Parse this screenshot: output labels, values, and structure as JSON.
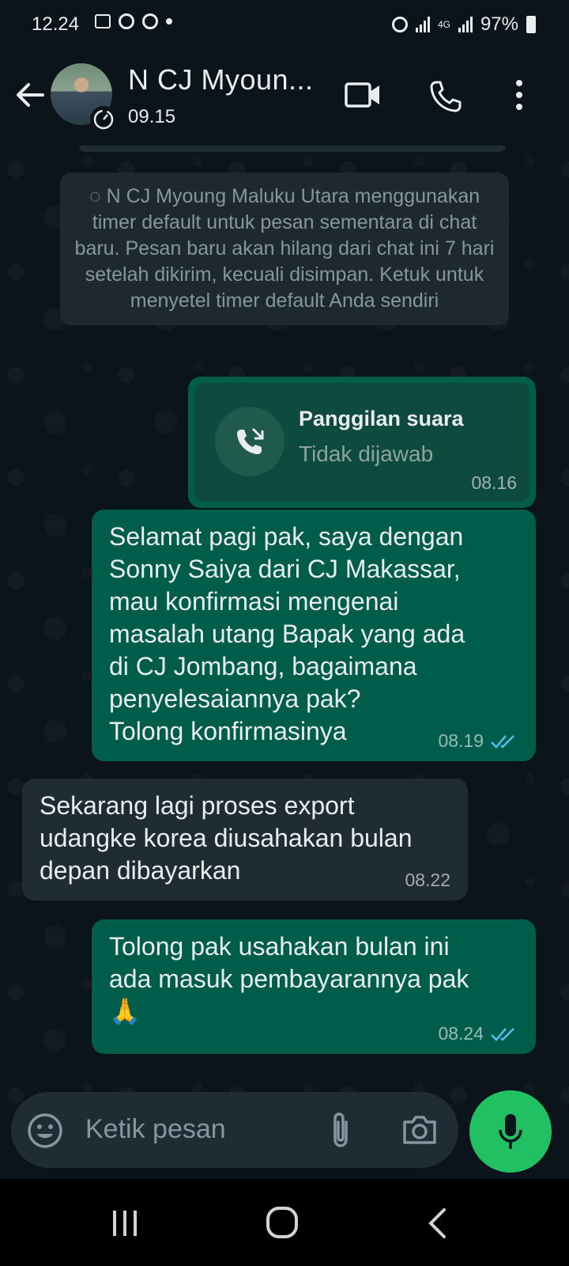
{
  "status_bar": {
    "time": "12.24",
    "battery": "97%",
    "network": "4G"
  },
  "header": {
    "contact_name": "N CJ Myoun...",
    "status": "09.15"
  },
  "system_message": "N CJ Myoung Maluku Utara menggunakan timer default untuk pesan sementara di chat baru. Pesan baru akan hilang dari chat ini 7 hari setelah dikirim, kecuali disimpan. Ketuk untuk menyetel timer default Anda sendiri",
  "messages": [
    {
      "type": "call",
      "title": "Panggilan suara",
      "subtitle": "Tidak dijawab",
      "time": "08.16"
    },
    {
      "type": "outgoing",
      "text": "Selamat pagi pak, saya dengan\nSonny Saiya dari CJ Makassar,\nmau konfirmasi mengenai\nmasalah utang Bapak yang ada\ndi CJ Jombang, bagaimana\npenyelesaiannya pak?\nTolong konfirmasinya",
      "time": "08.19",
      "status": "read"
    },
    {
      "type": "incoming",
      "text": "Sekarang lagi proses export\nudangke korea diusahakan bulan\ndepan dibayarkan",
      "time": "08.22"
    },
    {
      "type": "outgoing",
      "text": "Tolong pak usahakan bulan ini\nada masuk pembayarannya pak\n🙏",
      "time": "08.24",
      "status": "read"
    }
  ],
  "composer": {
    "placeholder": "Ketik pesan"
  },
  "colors": {
    "outgoing_bubble": "#005c4b",
    "incoming_bubble": "#202c33",
    "accent": "#21c063",
    "read_ticks": "#53bdeb"
  },
  "icons": [
    "back-arrow-icon",
    "timer-icon",
    "video-call-icon",
    "phone-icon",
    "more-icon",
    "missed-call-icon",
    "double-check-icon",
    "emoji-icon",
    "attach-icon",
    "camera-icon",
    "mic-icon",
    "recents-icon",
    "home-icon",
    "back-icon"
  ]
}
